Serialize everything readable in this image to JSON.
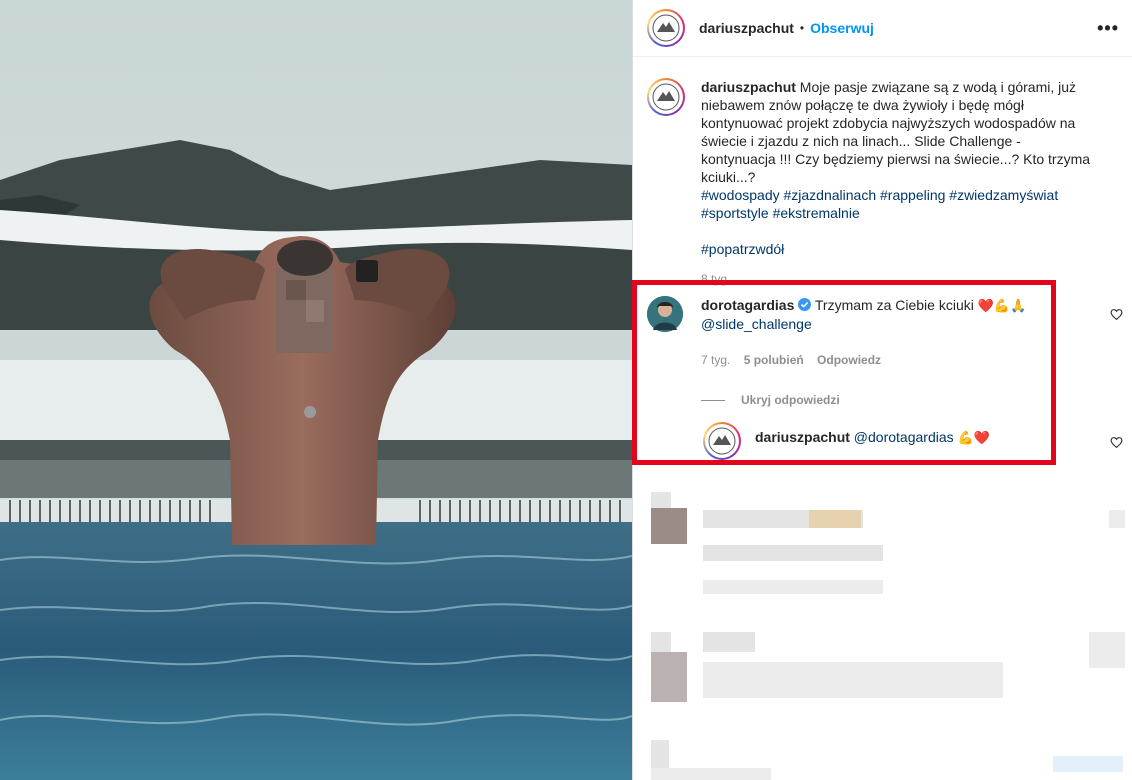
{
  "post": {
    "username": "dariuszpachut",
    "separator": "•",
    "follow_label": "Obserwuj",
    "more_label": "•••",
    "caption_text": "Moje pasje związane są z wodą i górami, już niebawem znów połączę te dwa żywioły i będę mógł kontynuować projekt zdobycia najwyższych wodospadów na świecie i zjazdu z nich na linach... Slide Challenge - kontynuacja !!! Czy będziemy pierwsi na świecie...? Kto trzyma kciuki...?",
    "hashtags_line1": "#wodospady #zjazdnalinach #rappeling #zwiedzamyświat",
    "hashtags_line2": "#sportstyle #ekstremalnie",
    "hashtags_line3": "#popatrzwdół",
    "time": "8 tyg."
  },
  "comment": {
    "username": "dorotagardias",
    "text": "Trzymam za Ciebie kciuki",
    "emojis": "❤️💪🙏",
    "mention": "@slide_challenge",
    "time": "7 tyg.",
    "likes": "5 polubień",
    "reply_label": "Odpowiedz",
    "hide_replies_label": "Ukryj odpowiedzi"
  },
  "reply": {
    "username": "dariuszpachut",
    "mention": "@dorotagardias",
    "emojis": "💪❤️"
  },
  "colors": {
    "accent": "#0095f6",
    "highlight": "#e3051b",
    "hashtag": "#00376b"
  }
}
